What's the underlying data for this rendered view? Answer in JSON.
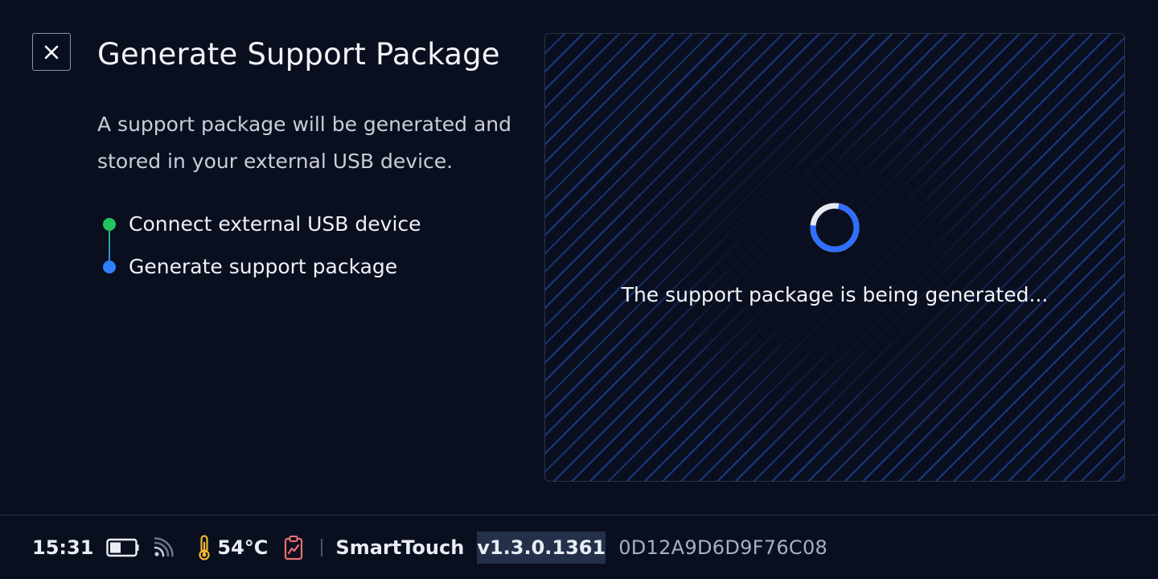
{
  "dialog": {
    "title": "Generate Support Package",
    "description": "A support package will be generated and stored in your external USB device.",
    "close_icon": "close-icon"
  },
  "steps": [
    {
      "label": "Connect external USB device",
      "state": "done",
      "color": "#22c55e"
    },
    {
      "label": "Generate support package",
      "state": "active",
      "color": "#2f80ff"
    }
  ],
  "status_panel": {
    "message": "The support package is being generated...",
    "spinner_icon": "loading-spinner-icon"
  },
  "footer": {
    "time": "15:31",
    "battery_icon": "battery-icon",
    "wifi_icon": "wifi-icon",
    "temperature_icon": "thermometer-icon",
    "temperature": "54°C",
    "clipboard_icon": "clipboard-chart-icon",
    "brand": "SmartTouch",
    "version": "v1.3.0.1361",
    "serial": "0D12A9D6D9F76C08"
  },
  "colors": {
    "background": "#0a0f1f",
    "accent": "#2f80ff",
    "success": "#22c55e",
    "warning": "#f5b833",
    "alert": "#f07070"
  }
}
